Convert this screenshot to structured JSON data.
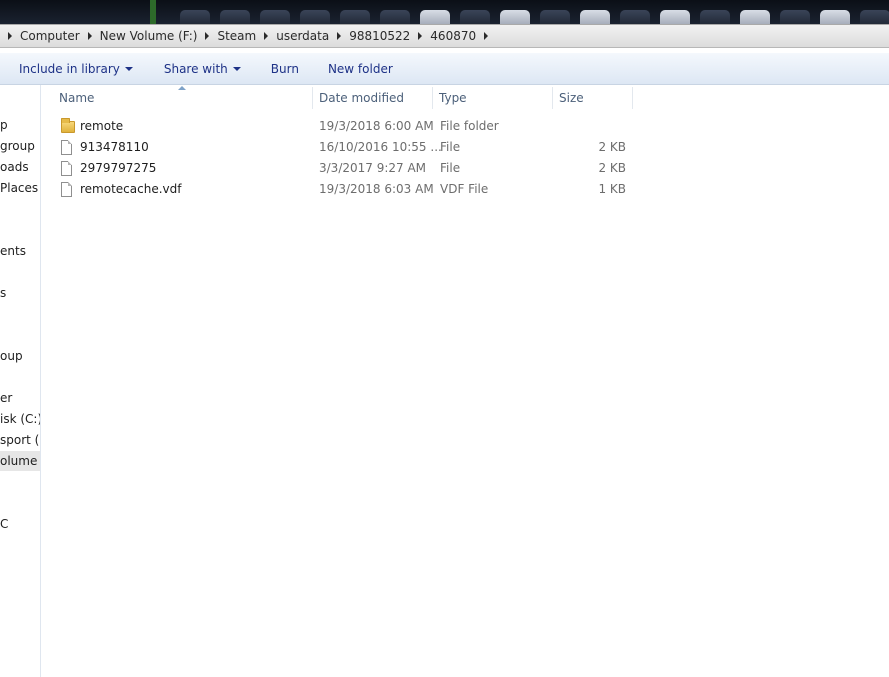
{
  "address_bar": {
    "crumbs": [
      "Computer",
      "New Volume (F:)",
      "Steam",
      "userdata",
      "98810522",
      "460870"
    ]
  },
  "toolbar": {
    "include_label": "Include in library",
    "share_label": "Share with",
    "burn_label": "Burn",
    "new_folder_label": "New folder"
  },
  "nav": {
    "items": [
      "p",
      "group",
      "oads",
      "Places",
      "ents",
      "s",
      "oup",
      "er",
      "isk (C:)",
      "sport (E",
      "olume (I",
      "C"
    ]
  },
  "columns": {
    "name": "Name",
    "date": "Date modified",
    "type": "Type",
    "size": "Size"
  },
  "files": [
    {
      "name": "remote",
      "date": "19/3/2018 6:00 AM",
      "type": "File folder",
      "size": "",
      "icon": "folder-icon"
    },
    {
      "name": "913478110",
      "date": "16/10/2016 10:55 ...",
      "type": "File",
      "size": "2 KB",
      "icon": "file-icon"
    },
    {
      "name": "2979797275",
      "date": "3/3/2017 9:27 AM",
      "type": "File",
      "size": "2 KB",
      "icon": "file-icon"
    },
    {
      "name": "remotecache.vdf",
      "date": "19/3/2018 6:03 AM",
      "type": "VDF File",
      "size": "1 KB",
      "icon": "file-icon"
    }
  ],
  "colors": {
    "toolbar_text": "#1e3287",
    "header_text": "#4c607a",
    "secondary_text": "#6d6d6d"
  }
}
